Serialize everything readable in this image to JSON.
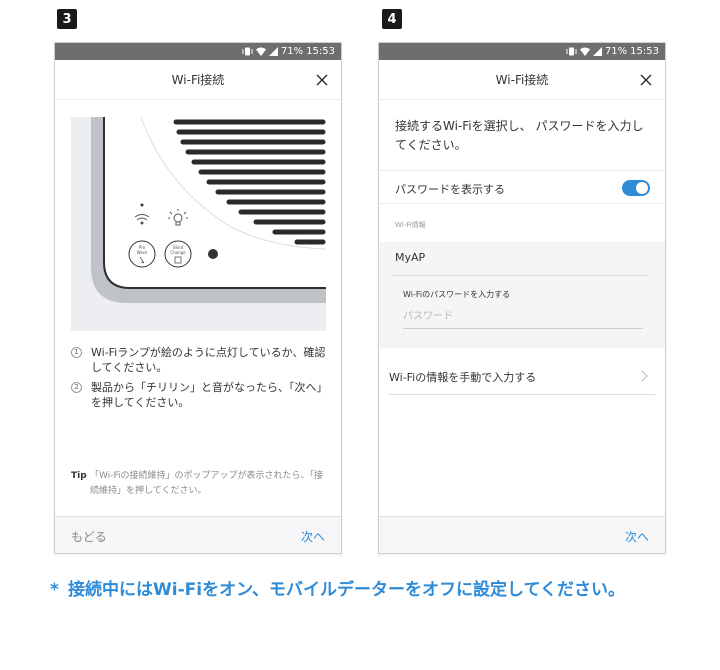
{
  "steps": [
    {
      "number": "3",
      "status": {
        "battery": "71%",
        "time": "15:53"
      },
      "title": "Wi-Fi接続",
      "device_buttons": {
        "wash": "Pre\nWash",
        "change": "Blind\nChange"
      },
      "instructions": [
        {
          "num": "1",
          "text": "Wi-Fiランプが絵のように点灯しているか、確認してください。"
        },
        {
          "num": "2",
          "text": "製品から「チリリン」と音がなったら、「次へ」を押してください。"
        }
      ],
      "tip_label": "Tip",
      "tip_text": "「Wi-Fiの接続維持」のポップアップが表示されたら、「接続維持」を押してください。",
      "back_label": "もどる",
      "next_label": "次へ"
    },
    {
      "number": "4",
      "status": {
        "battery": "71%",
        "time": "15:53"
      },
      "title": "Wi-Fi接続",
      "intro": "接続するWi-Fiを選択し、 パスワードを入力してください。",
      "show_password_label": "パスワードを表示する",
      "show_password_on": true,
      "wifi_info_label": "Wi-Fi情報",
      "ssid": "MyAP",
      "password_title": "Wi-Fiのパスワードを入力する",
      "password_placeholder": "パスワード",
      "manual_entry_label": "Wi-Fiの情報を手動で入力する",
      "next_label": "次へ"
    }
  ],
  "footnote": {
    "star": "*",
    "text": "接続中にはWi-Fiをオン、モバイルデーターをオフに設定してください。"
  },
  "colors": {
    "accent": "#2e8bd8",
    "status_bar": "#6e6e6e",
    "badge": "#1a1a1a"
  }
}
